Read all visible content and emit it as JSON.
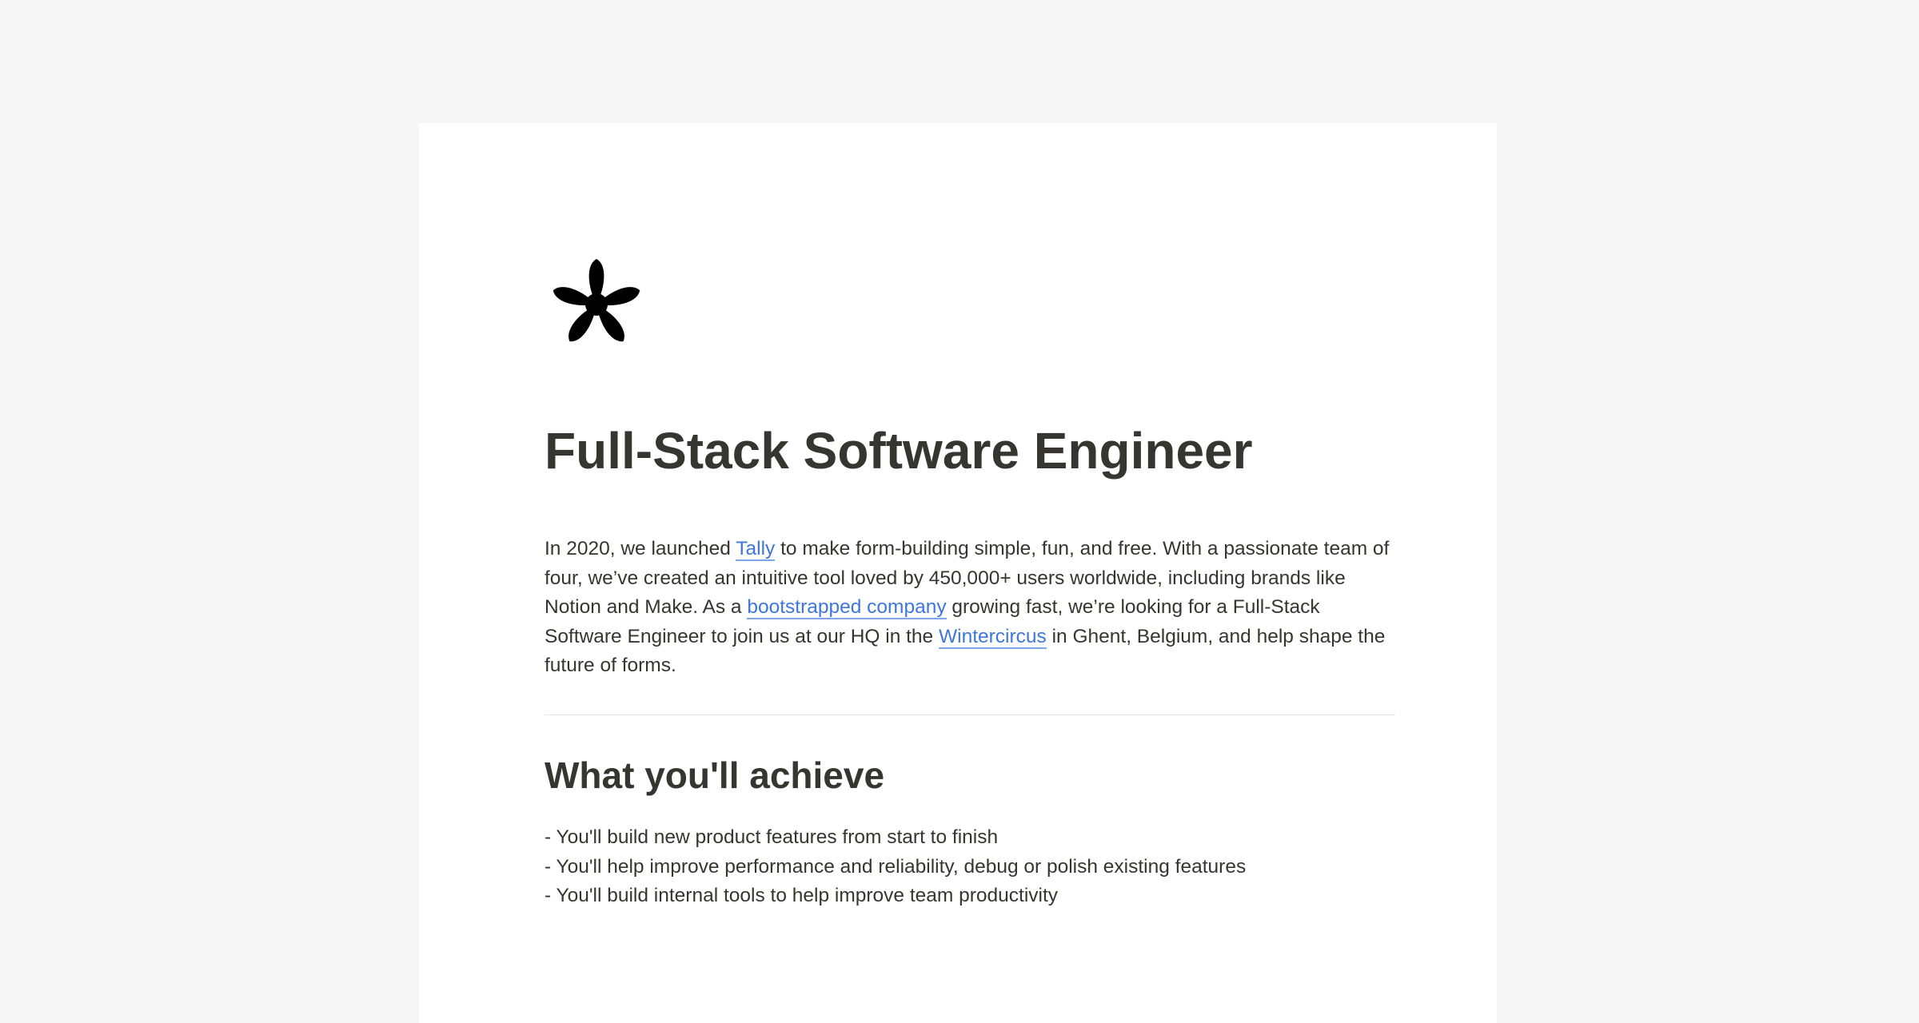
{
  "brand": {
    "logo_icon": "asterisk-logo-icon",
    "link_color": "#3e77dc",
    "text_color": "#37352f",
    "background": "#f6f6f6"
  },
  "job": {
    "title": "Full-Stack Software Engineer",
    "intro": {
      "part1": "In 2020, we launched ",
      "link_tally": "Tally",
      "part2": " to make form-building simple, fun, and free. With a passionate team of four, we’ve created an intuitive tool loved by 450,000+ users worldwide, including brands like Notion and Make. As a ",
      "link_bootstrapped": "bootstrapped company",
      "part3": " growing fast, we’re looking for a Full-Stack Software Engineer to join us at our HQ in the ",
      "link_wintercircus": "Wintercircus",
      "part4": " in Ghent, Belgium, and help shape the future of forms."
    }
  },
  "achieve": {
    "heading": "What you'll achieve",
    "items": [
      "- You'll build new product features from start to finish",
      "- You'll help improve performance and reliability, debug or polish existing features",
      "- You'll build internal tools to help improve team productivity"
    ]
  }
}
